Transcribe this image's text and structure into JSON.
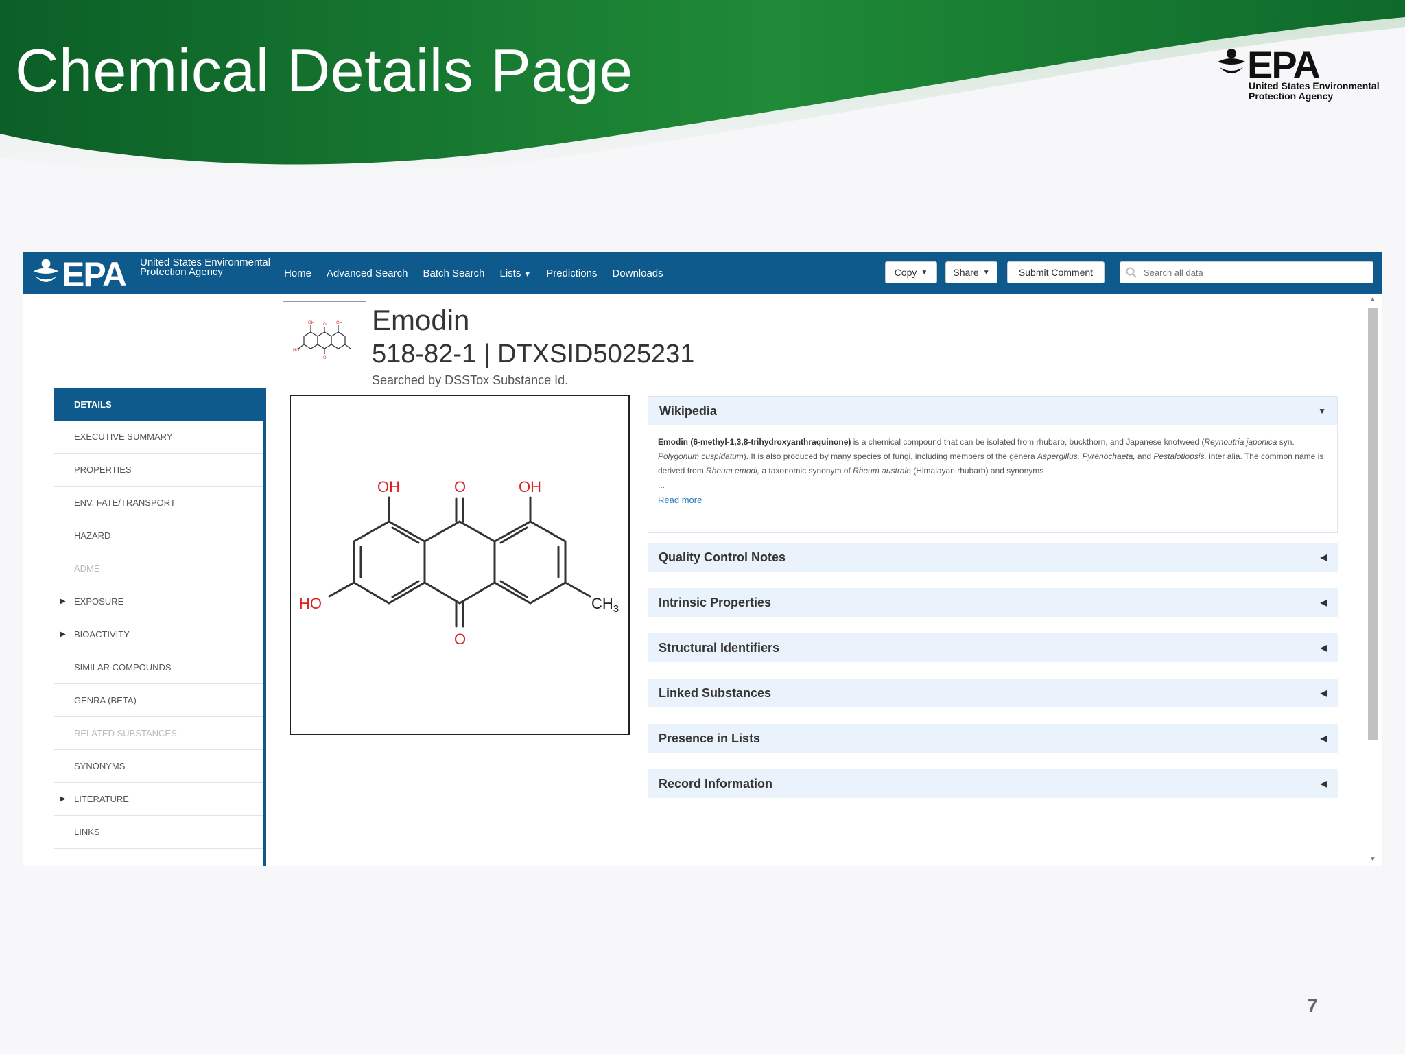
{
  "slide": {
    "title": "Chemical Details Page",
    "logo_word": "EPA",
    "logo_agency": "United States Environmental Protection Agency",
    "page_number": "7",
    "colors": {
      "green_dark": "#0d6b2c",
      "green_light": "#2a9a3f"
    }
  },
  "navbar": {
    "logo_word": "EPA",
    "logo_agency": "United States Environmental Protection Agency",
    "links": [
      "Home",
      "Advanced Search",
      "Batch Search",
      "Lists",
      "Predictions",
      "Downloads"
    ],
    "copy_label": "Copy",
    "share_label": "Share",
    "submit_label": "Submit Comment",
    "search_placeholder": "Search all data",
    "color": "#0e5a8c"
  },
  "chemical": {
    "name": "Emodin",
    "ids": "518-82-1 | DTXSID5025231",
    "search_note": "Searched by DSSTox Substance Id."
  },
  "structure_labels": {
    "oh_left": "OH",
    "o_top": "O",
    "oh_right": "OH",
    "ho": "HO",
    "ch3": "CH",
    "ch3_sub": "3",
    "o_bottom": "O"
  },
  "sidebar": {
    "items": [
      {
        "label": "DETAILS",
        "state": "active"
      },
      {
        "label": "EXECUTIVE SUMMARY"
      },
      {
        "label": "PROPERTIES"
      },
      {
        "label": "ENV. FATE/TRANSPORT"
      },
      {
        "label": "HAZARD"
      },
      {
        "label": "ADME",
        "state": "disabled"
      },
      {
        "label": "EXPOSURE",
        "expandable": true
      },
      {
        "label": "BIOACTIVITY",
        "expandable": true
      },
      {
        "label": "SIMILAR COMPOUNDS"
      },
      {
        "label": "GENRA (BETA)"
      },
      {
        "label": "RELATED SUBSTANCES",
        "state": "disabled"
      },
      {
        "label": "SYNONYMS"
      },
      {
        "label": "LITERATURE",
        "expandable": true
      },
      {
        "label": "LINKS"
      }
    ]
  },
  "wikipedia": {
    "title": "Wikipedia",
    "bold_lead": "Emodin (6-methyl-1,3,8-trihydroxyanthraquinone)",
    "text1": " is a chemical compound that can be isolated from rhubarb, buckthorn, and Japanese knotweed (",
    "italic1": "Reynoutria japonica",
    "text2": " syn. ",
    "italic2": "Polygonum cuspidatum",
    "text3": "). It is also produced by many species of fungi, including members of the genera ",
    "italic3": "Aspergillus, Pyrenochaeta,",
    "text4": " and ",
    "italic4": "Pestalotiopsis,",
    "text5": " inter alia. The common name is derived from ",
    "italic5": "Rheum emodi,",
    "text6": " a taxonomic synonym of ",
    "italic6": "Rheum australe",
    "text7": " (Himalayan rhubarb) and synonyms",
    "ellipsis": "...",
    "read_more": "Read more"
  },
  "panels": [
    "Quality Control Notes",
    "Intrinsic Properties",
    "Structural Identifiers",
    "Linked Substances",
    "Presence in Lists",
    "Record Information"
  ]
}
